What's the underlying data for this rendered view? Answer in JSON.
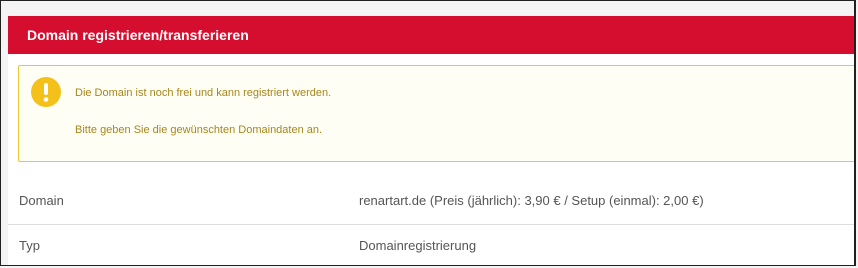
{
  "panel": {
    "title": "Domain registrieren/transferieren"
  },
  "alert": {
    "icon": "exclamation-circle-icon",
    "icon_color": "#f3c11a",
    "line1": "Die Domain ist noch frei und kann registriert werden.",
    "line2": "Bitte geben Sie die gewünschten Domaindaten an."
  },
  "details": {
    "rows": [
      {
        "label": "Domain",
        "value": "renartart.de (Preis (jährlich): 3,90 € / Setup (einmal): 2,00 €)"
      },
      {
        "label": "Typ",
        "value": "Domainregistrierung"
      }
    ]
  },
  "colors": {
    "header_bg": "#d50d2e",
    "alert_border": "#e7c83a",
    "alert_text": "#a6871c"
  }
}
